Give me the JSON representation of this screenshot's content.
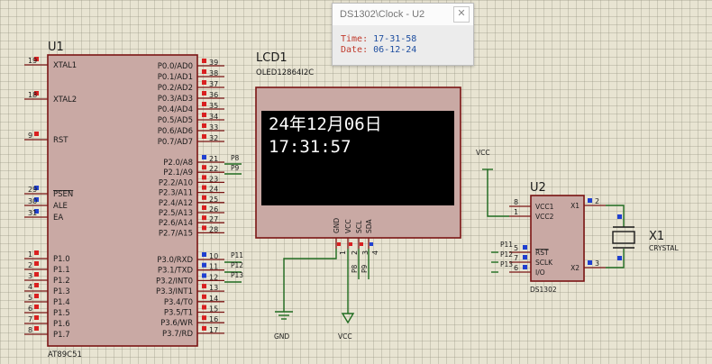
{
  "clock_window": {
    "title": "DS1302\\Clock - U2",
    "time_label": "Time:",
    "time_value": "17-31-58",
    "date_label": "Date:",
    "date_value": "06-12-24"
  },
  "lcd": {
    "ref": "LCD1",
    "part": "OLED12864I2C",
    "line1": "24年12月06日",
    "line2": "17:31:57",
    "pins": [
      "GND",
      "VCC",
      "SCL",
      "SDA"
    ],
    "pin_numbers": [
      "1",
      "2",
      "3",
      "4"
    ],
    "nets": [
      "P8",
      "P9"
    ]
  },
  "mcu": {
    "ref": "U1",
    "part": "AT89C51",
    "left_pins": [
      {
        "num": "19",
        "name": "XTAL1"
      },
      {
        "num": "18",
        "name": "XTAL2"
      },
      {
        "num": "9",
        "name": "RST"
      },
      {
        "num": "29",
        "name": "PSEN"
      },
      {
        "num": "30",
        "name": "ALE"
      },
      {
        "num": "31",
        "name": "EA"
      },
      {
        "num": "1",
        "name": "P1.0"
      },
      {
        "num": "2",
        "name": "P1.1"
      },
      {
        "num": "3",
        "name": "P1.2"
      },
      {
        "num": "4",
        "name": "P1.3"
      },
      {
        "num": "5",
        "name": "P1.4"
      },
      {
        "num": "6",
        "name": "P1.5"
      },
      {
        "num": "7",
        "name": "P1.6"
      },
      {
        "num": "8",
        "name": "P1.7"
      }
    ],
    "right_pins": [
      {
        "num": "39",
        "name": "P0.0/AD0"
      },
      {
        "num": "38",
        "name": "P0.1/AD1"
      },
      {
        "num": "37",
        "name": "P0.2/AD2"
      },
      {
        "num": "36",
        "name": "P0.3/AD3"
      },
      {
        "num": "35",
        "name": "P0.4/AD4"
      },
      {
        "num": "34",
        "name": "P0.5/AD5"
      },
      {
        "num": "33",
        "name": "P0.6/AD6"
      },
      {
        "num": "32",
        "name": "P0.7/AD7"
      },
      {
        "num": "21",
        "name": "P2.0/A8"
      },
      {
        "num": "22",
        "name": "P2.1/A9"
      },
      {
        "num": "23",
        "name": "P2.2/A10"
      },
      {
        "num": "24",
        "name": "P2.3/A11"
      },
      {
        "num": "25",
        "name": "P2.4/A12"
      },
      {
        "num": "26",
        "name": "P2.5/A13"
      },
      {
        "num": "27",
        "name": "P2.6/A14"
      },
      {
        "num": "28",
        "name": "P2.7/A15"
      },
      {
        "num": "10",
        "name": "P3.0/RXD"
      },
      {
        "num": "11",
        "name": "P3.1/TXD"
      },
      {
        "num": "12",
        "name": "P3.2/INT0"
      },
      {
        "num": "13",
        "name": "P3.3/INT1"
      },
      {
        "num": "14",
        "name": "P3.4/T0"
      },
      {
        "num": "15",
        "name": "P3.5/T1"
      },
      {
        "num": "16",
        "name": "P3.6/WR"
      },
      {
        "num": "17",
        "name": "P3.7/RD"
      }
    ],
    "nets_p2": [
      "P8",
      "P9"
    ],
    "nets_p3": [
      "P11",
      "P12",
      "P13"
    ]
  },
  "rtc": {
    "ref": "U2",
    "part": "DS1302",
    "left_pins": [
      {
        "num": "8",
        "name": "VCC1"
      },
      {
        "num": "1",
        "name": "VCC2"
      },
      {
        "num": "5",
        "name": "RST"
      },
      {
        "num": "7",
        "name": "SCLK"
      },
      {
        "num": "6",
        "name": "I/O"
      }
    ],
    "right_pins": [
      {
        "num": "2",
        "name": "X1"
      },
      {
        "num": "3",
        "name": "X2"
      }
    ],
    "nets": [
      "P11",
      "P12",
      "P13"
    ]
  },
  "crystal": {
    "ref": "X1",
    "part": "CRYSTAL"
  },
  "power": {
    "vcc_label": "VCC",
    "gnd_label": "GND"
  },
  "colors": {
    "wire": "#1f6b1f",
    "body_fill": "#c9a9a4",
    "body_stroke": "#7a1414",
    "pin_stroke": "#7a1414",
    "lcd_screen": "#000000",
    "pin_marker_red": "#d92020",
    "pin_marker_blue": "#2040d0"
  }
}
